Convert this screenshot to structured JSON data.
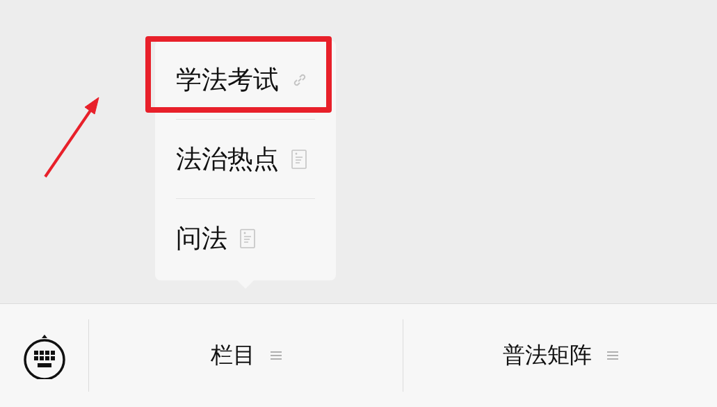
{
  "menus": [
    {
      "label": "栏目",
      "submenu": [
        {
          "label": "学法考试",
          "kind": "link",
          "highlighted": true
        },
        {
          "label": "法治热点",
          "kind": "article",
          "highlighted": false
        },
        {
          "label": "问法",
          "kind": "article",
          "highlighted": false
        }
      ]
    },
    {
      "label": "普法矩阵"
    }
  ]
}
